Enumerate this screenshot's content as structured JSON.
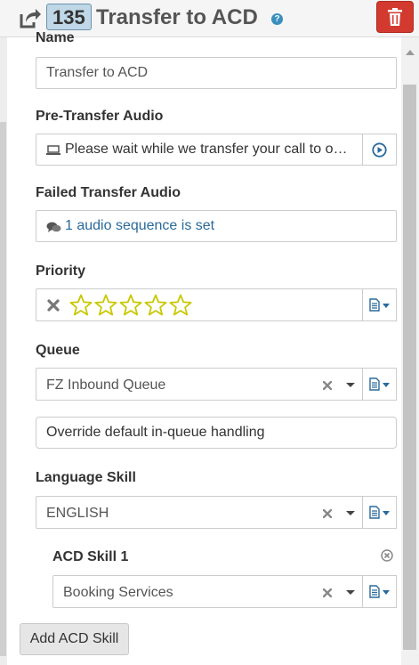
{
  "header": {
    "node_id": "135",
    "title": "Transfer to ACD",
    "help_icon_glyph": "?"
  },
  "form": {
    "name_label": "Name",
    "name_value": "Transfer to ACD",
    "pre_transfer_label": "Pre-Transfer Audio",
    "pre_transfer_value": "Please wait while we transfer your call to o…",
    "failed_transfer_label": "Failed Transfer Audio",
    "failed_transfer_value": "1 audio sequence is set",
    "priority_label": "Priority",
    "priority_stars_total": 5,
    "priority_stars_filled": 0,
    "queue_label": "Queue",
    "queue_value": "FZ Inbound Queue",
    "override_button_label": "Override default in-queue handling",
    "language_skill_label": "Language Skill",
    "language_skill_value": "ENGLISH",
    "acd_skill_label": "ACD Skill 1",
    "acd_skill_value": "Booking Services",
    "add_acd_skill_label": "Add ACD Skill"
  },
  "colors": {
    "accent": "#2a6a9a",
    "delete": "#d33a2f",
    "star": "#c8c800"
  },
  "icons": [
    "share-icon",
    "help-icon",
    "trash-icon",
    "laptop-icon",
    "play-icon",
    "chat-icon",
    "clear-icon",
    "star-icon",
    "document-icon",
    "chevron-down-icon",
    "remove-circle-icon"
  ]
}
